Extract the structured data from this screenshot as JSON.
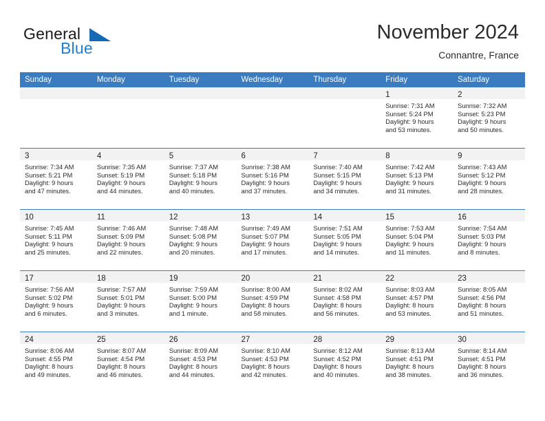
{
  "brand": {
    "word1": "General",
    "word2": "Blue",
    "logo_icon": "triangle-logo-icon",
    "accent_color": "#1c7fd4"
  },
  "header": {
    "title": "November 2024",
    "subtitle": "Connantre, France"
  },
  "calendar": {
    "header_color": "#3a7cbf",
    "weekday_headers": [
      "Sunday",
      "Monday",
      "Tuesday",
      "Wednesday",
      "Thursday",
      "Friday",
      "Saturday"
    ],
    "weeks": [
      [
        {
          "day": "",
          "lines": [
            "",
            "",
            "",
            ""
          ],
          "empty": true
        },
        {
          "day": "",
          "lines": [
            "",
            "",
            "",
            ""
          ],
          "empty": true
        },
        {
          "day": "",
          "lines": [
            "",
            "",
            "",
            ""
          ],
          "empty": true
        },
        {
          "day": "",
          "lines": [
            "",
            "",
            "",
            ""
          ],
          "empty": true
        },
        {
          "day": "",
          "lines": [
            "",
            "",
            "",
            ""
          ],
          "empty": true
        },
        {
          "day": "1",
          "lines": [
            "Sunrise: 7:31 AM",
            "Sunset: 5:24 PM",
            "Daylight: 9 hours",
            "and 53 minutes."
          ],
          "empty": false
        },
        {
          "day": "2",
          "lines": [
            "Sunrise: 7:32 AM",
            "Sunset: 5:23 PM",
            "Daylight: 9 hours",
            "and 50 minutes."
          ],
          "empty": false
        }
      ],
      [
        {
          "day": "3",
          "lines": [
            "Sunrise: 7:34 AM",
            "Sunset: 5:21 PM",
            "Daylight: 9 hours",
            "and 47 minutes."
          ],
          "empty": false
        },
        {
          "day": "4",
          "lines": [
            "Sunrise: 7:35 AM",
            "Sunset: 5:19 PM",
            "Daylight: 9 hours",
            "and 44 minutes."
          ],
          "empty": false
        },
        {
          "day": "5",
          "lines": [
            "Sunrise: 7:37 AM",
            "Sunset: 5:18 PM",
            "Daylight: 9 hours",
            "and 40 minutes."
          ],
          "empty": false
        },
        {
          "day": "6",
          "lines": [
            "Sunrise: 7:38 AM",
            "Sunset: 5:16 PM",
            "Daylight: 9 hours",
            "and 37 minutes."
          ],
          "empty": false
        },
        {
          "day": "7",
          "lines": [
            "Sunrise: 7:40 AM",
            "Sunset: 5:15 PM",
            "Daylight: 9 hours",
            "and 34 minutes."
          ],
          "empty": false
        },
        {
          "day": "8",
          "lines": [
            "Sunrise: 7:42 AM",
            "Sunset: 5:13 PM",
            "Daylight: 9 hours",
            "and 31 minutes."
          ],
          "empty": false
        },
        {
          "day": "9",
          "lines": [
            "Sunrise: 7:43 AM",
            "Sunset: 5:12 PM",
            "Daylight: 9 hours",
            "and 28 minutes."
          ],
          "empty": false
        }
      ],
      [
        {
          "day": "10",
          "lines": [
            "Sunrise: 7:45 AM",
            "Sunset: 5:11 PM",
            "Daylight: 9 hours",
            "and 25 minutes."
          ],
          "empty": false
        },
        {
          "day": "11",
          "lines": [
            "Sunrise: 7:46 AM",
            "Sunset: 5:09 PM",
            "Daylight: 9 hours",
            "and 22 minutes."
          ],
          "empty": false
        },
        {
          "day": "12",
          "lines": [
            "Sunrise: 7:48 AM",
            "Sunset: 5:08 PM",
            "Daylight: 9 hours",
            "and 20 minutes."
          ],
          "empty": false
        },
        {
          "day": "13",
          "lines": [
            "Sunrise: 7:49 AM",
            "Sunset: 5:07 PM",
            "Daylight: 9 hours",
            "and 17 minutes."
          ],
          "empty": false
        },
        {
          "day": "14",
          "lines": [
            "Sunrise: 7:51 AM",
            "Sunset: 5:05 PM",
            "Daylight: 9 hours",
            "and 14 minutes."
          ],
          "empty": false
        },
        {
          "day": "15",
          "lines": [
            "Sunrise: 7:53 AM",
            "Sunset: 5:04 PM",
            "Daylight: 9 hours",
            "and 11 minutes."
          ],
          "empty": false
        },
        {
          "day": "16",
          "lines": [
            "Sunrise: 7:54 AM",
            "Sunset: 5:03 PM",
            "Daylight: 9 hours",
            "and 8 minutes."
          ],
          "empty": false
        }
      ],
      [
        {
          "day": "17",
          "lines": [
            "Sunrise: 7:56 AM",
            "Sunset: 5:02 PM",
            "Daylight: 9 hours",
            "and 6 minutes."
          ],
          "empty": false
        },
        {
          "day": "18",
          "lines": [
            "Sunrise: 7:57 AM",
            "Sunset: 5:01 PM",
            "Daylight: 9 hours",
            "and 3 minutes."
          ],
          "empty": false
        },
        {
          "day": "19",
          "lines": [
            "Sunrise: 7:59 AM",
            "Sunset: 5:00 PM",
            "Daylight: 9 hours",
            "and 1 minute."
          ],
          "empty": false
        },
        {
          "day": "20",
          "lines": [
            "Sunrise: 8:00 AM",
            "Sunset: 4:59 PM",
            "Daylight: 8 hours",
            "and 58 minutes."
          ],
          "empty": false
        },
        {
          "day": "21",
          "lines": [
            "Sunrise: 8:02 AM",
            "Sunset: 4:58 PM",
            "Daylight: 8 hours",
            "and 56 minutes."
          ],
          "empty": false
        },
        {
          "day": "22",
          "lines": [
            "Sunrise: 8:03 AM",
            "Sunset: 4:57 PM",
            "Daylight: 8 hours",
            "and 53 minutes."
          ],
          "empty": false
        },
        {
          "day": "23",
          "lines": [
            "Sunrise: 8:05 AM",
            "Sunset: 4:56 PM",
            "Daylight: 8 hours",
            "and 51 minutes."
          ],
          "empty": false
        }
      ],
      [
        {
          "day": "24",
          "lines": [
            "Sunrise: 8:06 AM",
            "Sunset: 4:55 PM",
            "Daylight: 8 hours",
            "and 49 minutes."
          ],
          "empty": false
        },
        {
          "day": "25",
          "lines": [
            "Sunrise: 8:07 AM",
            "Sunset: 4:54 PM",
            "Daylight: 8 hours",
            "and 46 minutes."
          ],
          "empty": false
        },
        {
          "day": "26",
          "lines": [
            "Sunrise: 8:09 AM",
            "Sunset: 4:53 PM",
            "Daylight: 8 hours",
            "and 44 minutes."
          ],
          "empty": false
        },
        {
          "day": "27",
          "lines": [
            "Sunrise: 8:10 AM",
            "Sunset: 4:53 PM",
            "Daylight: 8 hours",
            "and 42 minutes."
          ],
          "empty": false
        },
        {
          "day": "28",
          "lines": [
            "Sunrise: 8:12 AM",
            "Sunset: 4:52 PM",
            "Daylight: 8 hours",
            "and 40 minutes."
          ],
          "empty": false
        },
        {
          "day": "29",
          "lines": [
            "Sunrise: 8:13 AM",
            "Sunset: 4:51 PM",
            "Daylight: 8 hours",
            "and 38 minutes."
          ],
          "empty": false
        },
        {
          "day": "30",
          "lines": [
            "Sunrise: 8:14 AM",
            "Sunset: 4:51 PM",
            "Daylight: 8 hours",
            "and 36 minutes."
          ],
          "empty": false
        }
      ]
    ]
  }
}
